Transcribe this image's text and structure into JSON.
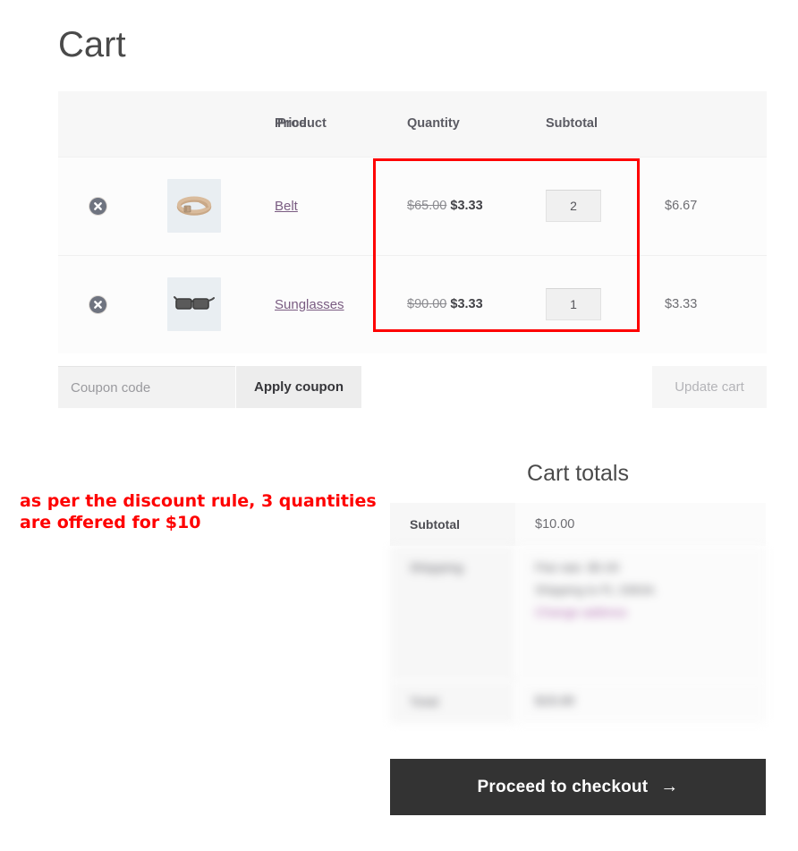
{
  "page": {
    "title": "Cart"
  },
  "cart_table": {
    "headers": [
      "",
      "",
      "Product",
      "Price",
      "Quantity",
      "Subtotal"
    ],
    "rows": [
      {
        "remove_icon": "remove-circle-icon",
        "thumb_icon": "belt-thumbnail-icon",
        "product": "Belt",
        "price_original": "$65.00",
        "price_discounted": "$3.33",
        "quantity": "2",
        "subtotal": "$6.67"
      },
      {
        "remove_icon": "remove-circle-icon",
        "thumb_icon": "sunglasses-thumbnail-icon",
        "product": "Sunglasses",
        "price_original": "$90.00",
        "price_discounted": "$3.33",
        "quantity": "1",
        "subtotal": "$3.33"
      }
    ]
  },
  "coupon": {
    "placeholder": "Coupon code",
    "value": "",
    "apply_label": "Apply coupon",
    "update_label": "Update cart"
  },
  "annotation": {
    "note_line1": "as per the discount rule, 3 quantities",
    "note_line2": "are offered for $10",
    "color": "#fe0000"
  },
  "cart_totals": {
    "title": "Cart totals",
    "rows": [
      {
        "label": "Subtotal",
        "value": "$10.00",
        "blurred": false
      },
      {
        "label": "Shipping",
        "value": "Flat rate: $5.00",
        "blurred": true
      },
      {
        "label": "Total",
        "value": "$15.00",
        "blurred": true
      }
    ],
    "shipping_options": [
      "Flat rate: $5.00",
      "Shipping to FL 33634.",
      "Change address"
    ],
    "checkout_label": "Proceed to checkout",
    "checkout_arrow": "→"
  }
}
